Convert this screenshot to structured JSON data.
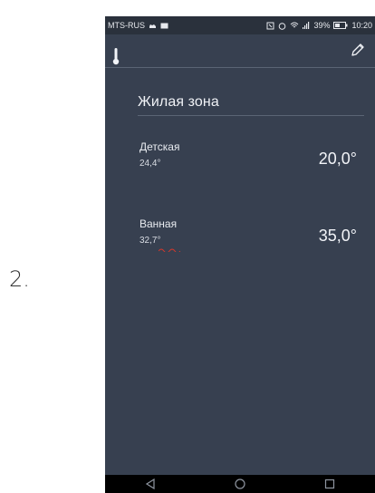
{
  "outer_label": "2.",
  "status": {
    "carrier": "MTS-RUS",
    "battery": "39%",
    "time": "10:20"
  },
  "main": {
    "section_title": "Жилая зона",
    "rooms": [
      {
        "name": "Детская",
        "current_temp": "24,4°",
        "target_temp": "20,0°"
      },
      {
        "name": "Ванная",
        "current_temp": "32,7°",
        "target_temp": "35,0°"
      }
    ]
  },
  "colors": {
    "app_background": "#374050",
    "status_bar": "#2a313c",
    "nav_bar": "#000000",
    "text": "#f0f2f6"
  }
}
